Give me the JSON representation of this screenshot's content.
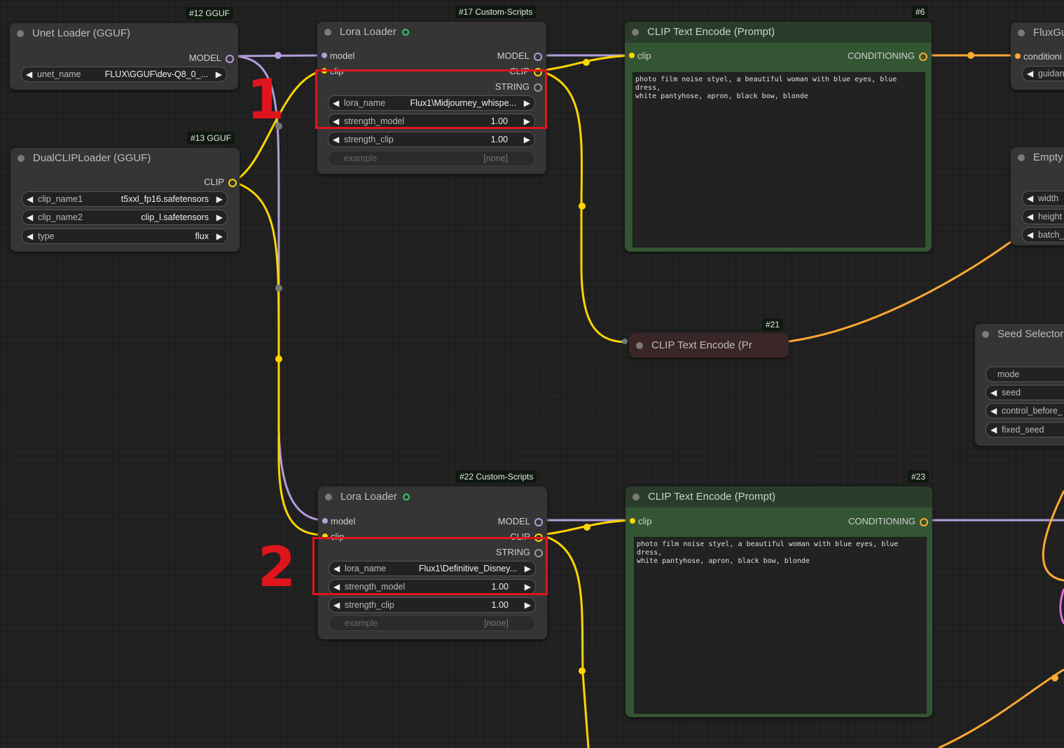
{
  "nodes": {
    "unet": {
      "badge": "#12 GGUF",
      "title": "Unet Loader (GGUF)",
      "output": "MODEL",
      "widgets": [
        {
          "label": "unet_name",
          "value": "FLUX\\GGUF\\dev-Q8_0_..."
        }
      ]
    },
    "dualclip": {
      "badge": "#13 GGUF",
      "title": "DualCLIPLoader (GGUF)",
      "output": "CLIP",
      "widgets": [
        {
          "label": "clip_name1",
          "value": "t5xxl_fp16.safetensors"
        },
        {
          "label": "clip_name2",
          "value": "clip_l.safetensors"
        },
        {
          "label": "type",
          "value": "flux"
        }
      ]
    },
    "lora1": {
      "badge": "#17 Custom-Scripts",
      "title": "Lora Loader",
      "inputs": [
        "model",
        "clip"
      ],
      "outputs": [
        "MODEL",
        "CLIP",
        "STRING"
      ],
      "widgets": [
        {
          "label": "lora_name",
          "value": "Flux1\\Midjourney_whispe..."
        },
        {
          "label": "strength_model",
          "value": "1.00"
        },
        {
          "label": "strength_clip",
          "value": "1.00"
        },
        {
          "label": "example",
          "value": "[none]"
        }
      ]
    },
    "clip6": {
      "badge": "#6",
      "title": "CLIP Text Encode (Prompt)",
      "input": "clip",
      "output": "CONDITIONING",
      "text": "photo film noise styel, a beautiful woman with blue eyes, blue dress,\nwhite pantyhose, apron, black bow, blonde"
    },
    "fluxg": {
      "title": "FluxGu",
      "input": "conditioni",
      "widget": "guidan"
    },
    "empty": {
      "title": "Empty",
      "widgets": [
        "width",
        "height",
        "batch_"
      ]
    },
    "clip21": {
      "badge": "#21",
      "title": "CLIP Text Encode (Pr"
    },
    "seed": {
      "title": "Seed Selector",
      "widgets": [
        "mode",
        "seed",
        "control_before_",
        "fixed_seed"
      ]
    },
    "lora2": {
      "badge": "#22 Custom-Scripts",
      "title": "Lora Loader",
      "inputs": [
        "model",
        "clip"
      ],
      "outputs": [
        "MODEL",
        "CLIP",
        "STRING"
      ],
      "widgets": [
        {
          "label": "lora_name",
          "value": "Flux1\\Definitive_Disney..."
        },
        {
          "label": "strength_model",
          "value": "1.00"
        },
        {
          "label": "strength_clip",
          "value": "1.00"
        },
        {
          "label": "example",
          "value": "[none]"
        }
      ]
    },
    "clip23": {
      "badge": "#23",
      "title": "CLIP Text Encode (Prompt)",
      "input": "clip",
      "output": "CONDITIONING",
      "text": "photo film noise styel, a beautiful woman with blue eyes, blue dress,\nwhite pantyhose, apron, black bow, blonde"
    }
  },
  "annotations": {
    "marker1": "1",
    "marker2": "2"
  },
  "colors": {
    "model_wire": "#b39ddb",
    "clip_wire": "#ffd500",
    "conditioning_wire": "#ffa931",
    "annotation_red": "#e0141c",
    "green_node": "#335533"
  }
}
